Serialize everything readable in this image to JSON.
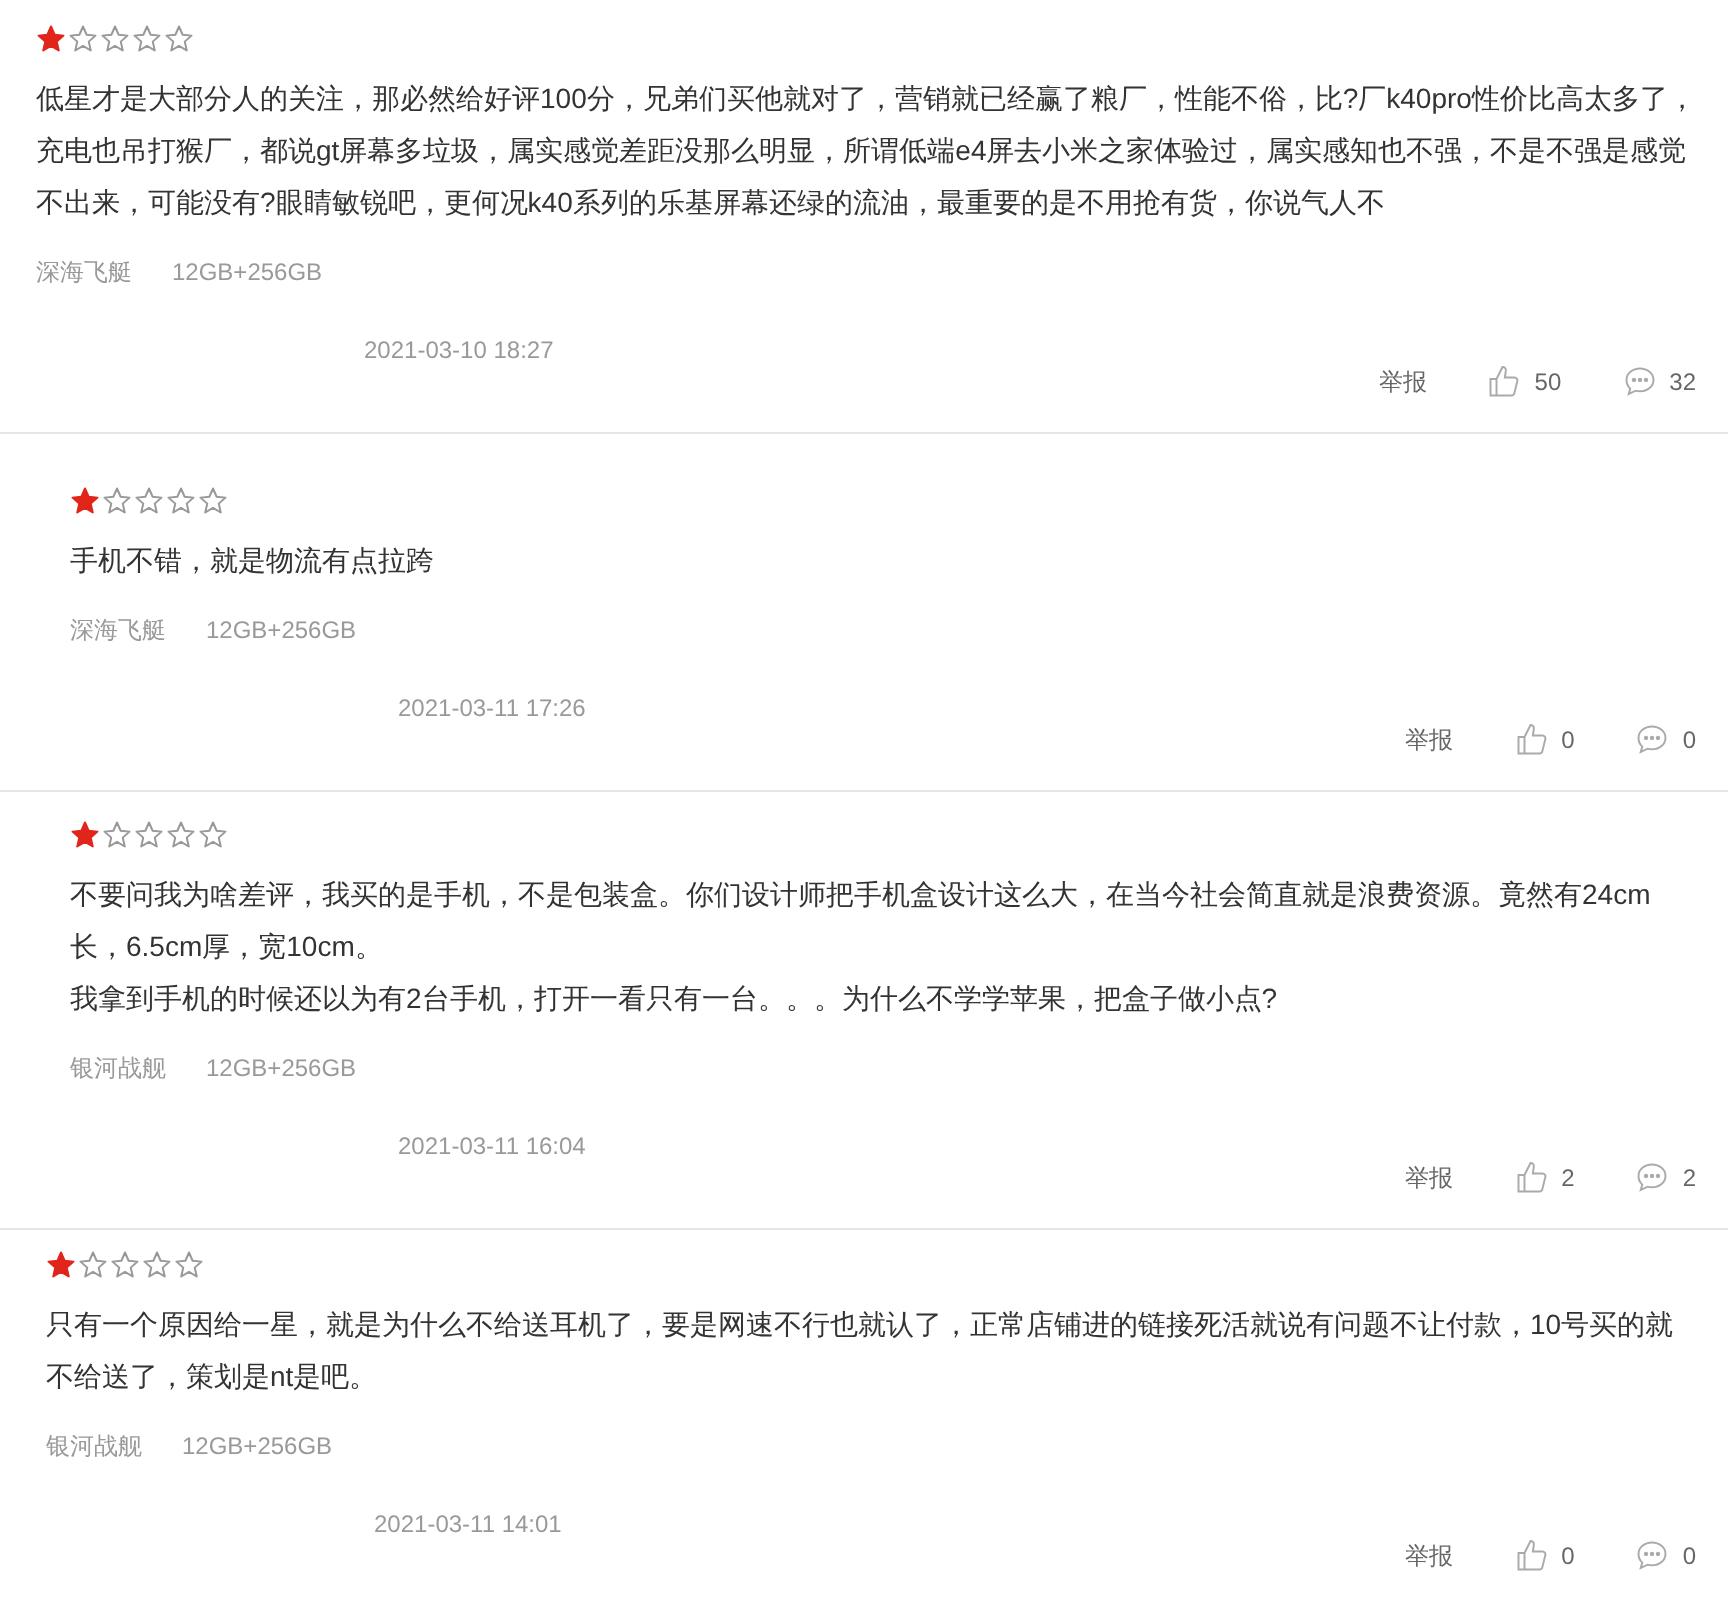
{
  "reviews": [
    {
      "stars": 1,
      "text": [
        "低星才是大部分人的关注，那必然给好评100分，兄弟们买他就对了，营销就已经赢了粮厂，性能不俗，比?厂k40pro性价比高太多了，充电也吊打猴厂，都说gt屏幕多垃圾，属实感觉差距没那么明显，所谓低端e4屏去小米之家体验过，属实感知也不强，不是不强是感觉不出来，可能没有?眼睛敏锐吧，更何况k40系列的乐基屏幕还绿的流油，最重要的是不用抢有货，你说气人不"
      ],
      "user": "深海飞艇",
      "variant": "12GB+256GB",
      "date": "2021-03-10 18:27",
      "report": "举报",
      "likes": "50",
      "replies": "32"
    },
    {
      "stars": 1,
      "text": [
        "手机不错，就是物流有点拉跨"
      ],
      "user": "深海飞艇",
      "variant": "12GB+256GB",
      "date": "2021-03-11 17:26",
      "report": "举报",
      "likes": "0",
      "replies": "0"
    },
    {
      "stars": 1,
      "text": [
        "不要问我为啥差评，我买的是手机，不是包装盒。你们设计师把手机盒设计这么大，在当今社会简直就是浪费资源。竟然有24cm长，6.5cm厚，宽10cm。",
        "我拿到手机的时候还以为有2台手机，打开一看只有一台。。。为什么不学学苹果，把盒子做小点?"
      ],
      "user": "银河战舰",
      "variant": "12GB+256GB",
      "date": "2021-03-11 16:04",
      "report": "举报",
      "likes": "2",
      "replies": "2"
    },
    {
      "stars": 1,
      "text": [
        "只有一个原因给一星，就是为什么不给送耳机了，要是网速不行也就认了，正常店铺进的链接死活就说有问题不让付款，10号买的就不给送了，策划是nt是吧。"
      ],
      "user": "银河战舰",
      "variant": "12GB+256GB",
      "date": "2021-03-11 14:01",
      "report": "举报",
      "likes": "0",
      "replies": "0"
    }
  ]
}
